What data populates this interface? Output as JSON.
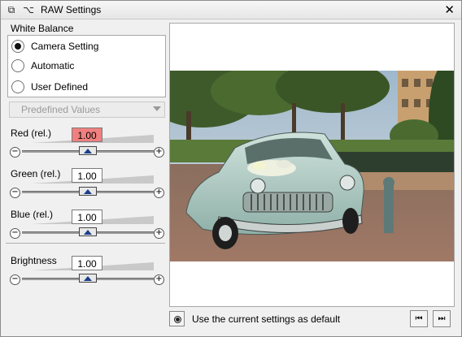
{
  "window": {
    "title": "RAW Settings"
  },
  "white_balance": {
    "label": "White Balance",
    "options": [
      {
        "label": "Camera Setting",
        "checked": true
      },
      {
        "label": "Automatic",
        "checked": false
      },
      {
        "label": "User Defined",
        "checked": false
      }
    ]
  },
  "predefined": {
    "label": "Predefined Values"
  },
  "sliders": [
    {
      "label": "Red (rel.)",
      "value": "1.00",
      "active": true
    },
    {
      "label": "Green (rel.)",
      "value": "1.00",
      "active": false
    },
    {
      "label": "Blue (rel.)",
      "value": "1.00",
      "active": false
    },
    {
      "label": "Brightness",
      "value": "1.00",
      "active": false
    }
  ],
  "status": {
    "default_text": "Use the current settings as default"
  },
  "icons": {
    "app": "copy-icon",
    "options": "scissors-icon",
    "close": "close-icon",
    "minus": "minus-icon",
    "plus": "plus-icon",
    "prev": "skip-prev-icon",
    "next": "skip-next-icon"
  }
}
